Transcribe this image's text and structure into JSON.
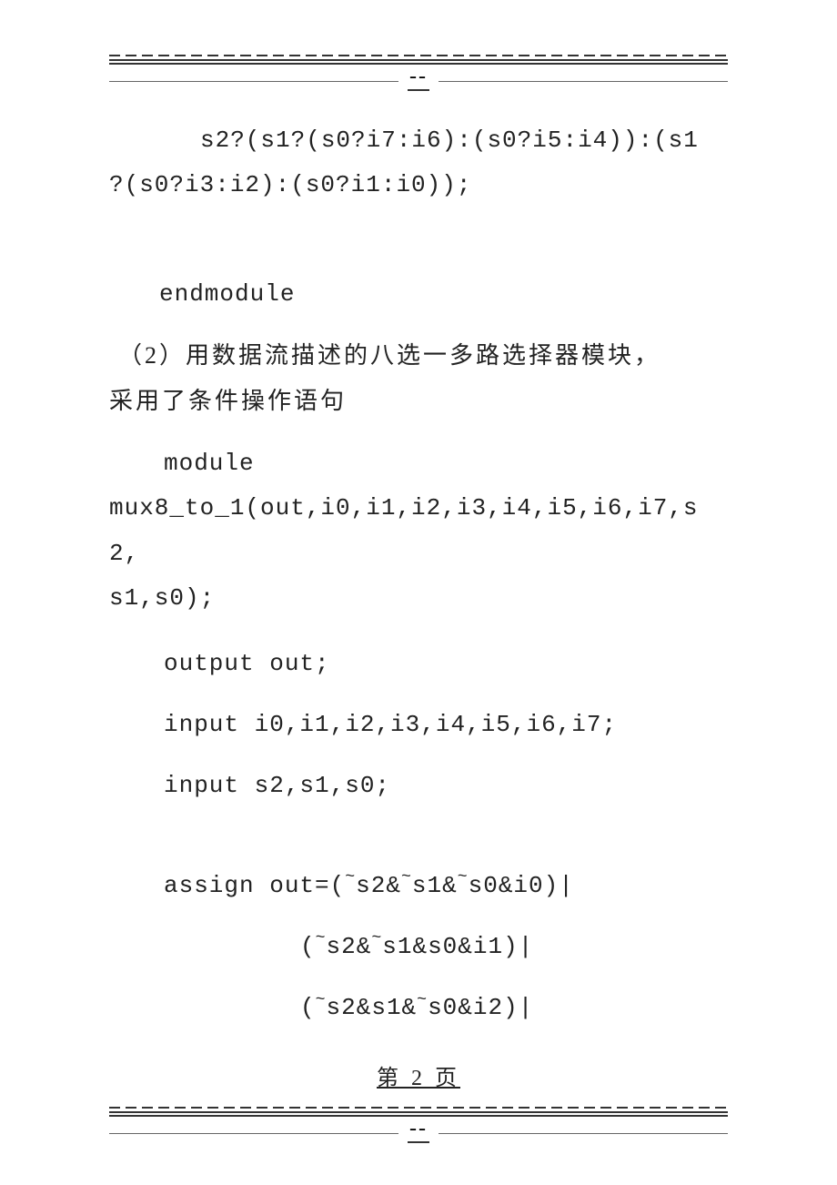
{
  "topMarker": "--",
  "code1_line1": "s2?(s1?(s0?i7:i6):(s0?i5:i4)):(s1",
  "code1_line2": "?(s0?i3:i2):(s0?i1:i0));",
  "endmodule": "endmodule",
  "desc_line1": "（2）用数据流描述的八选一多路选择器模块，",
  "desc_line2": "采用了条件操作语句",
  "module_kw": "module",
  "module_decl": "mux8_to_1(out,i0,i1,i2,i3,i4,i5,i6,i7,s2,",
  "module_decl2": "s1,s0);",
  "output_line": "output out;",
  "input_line1": "input i0,i1,i2,i3,i4,i5,i6,i7;",
  "input_line2": "input s2,s1,s0;",
  "assign_line1": "assign out=(~s2&~s1&~s0&i0)|",
  "assign_line2": "(~s2&~s1&s0&i1)|",
  "assign_line3": "(~s2&s1&~s0&i2)|",
  "page_number": "第 2 页",
  "bottomMarker": "--"
}
